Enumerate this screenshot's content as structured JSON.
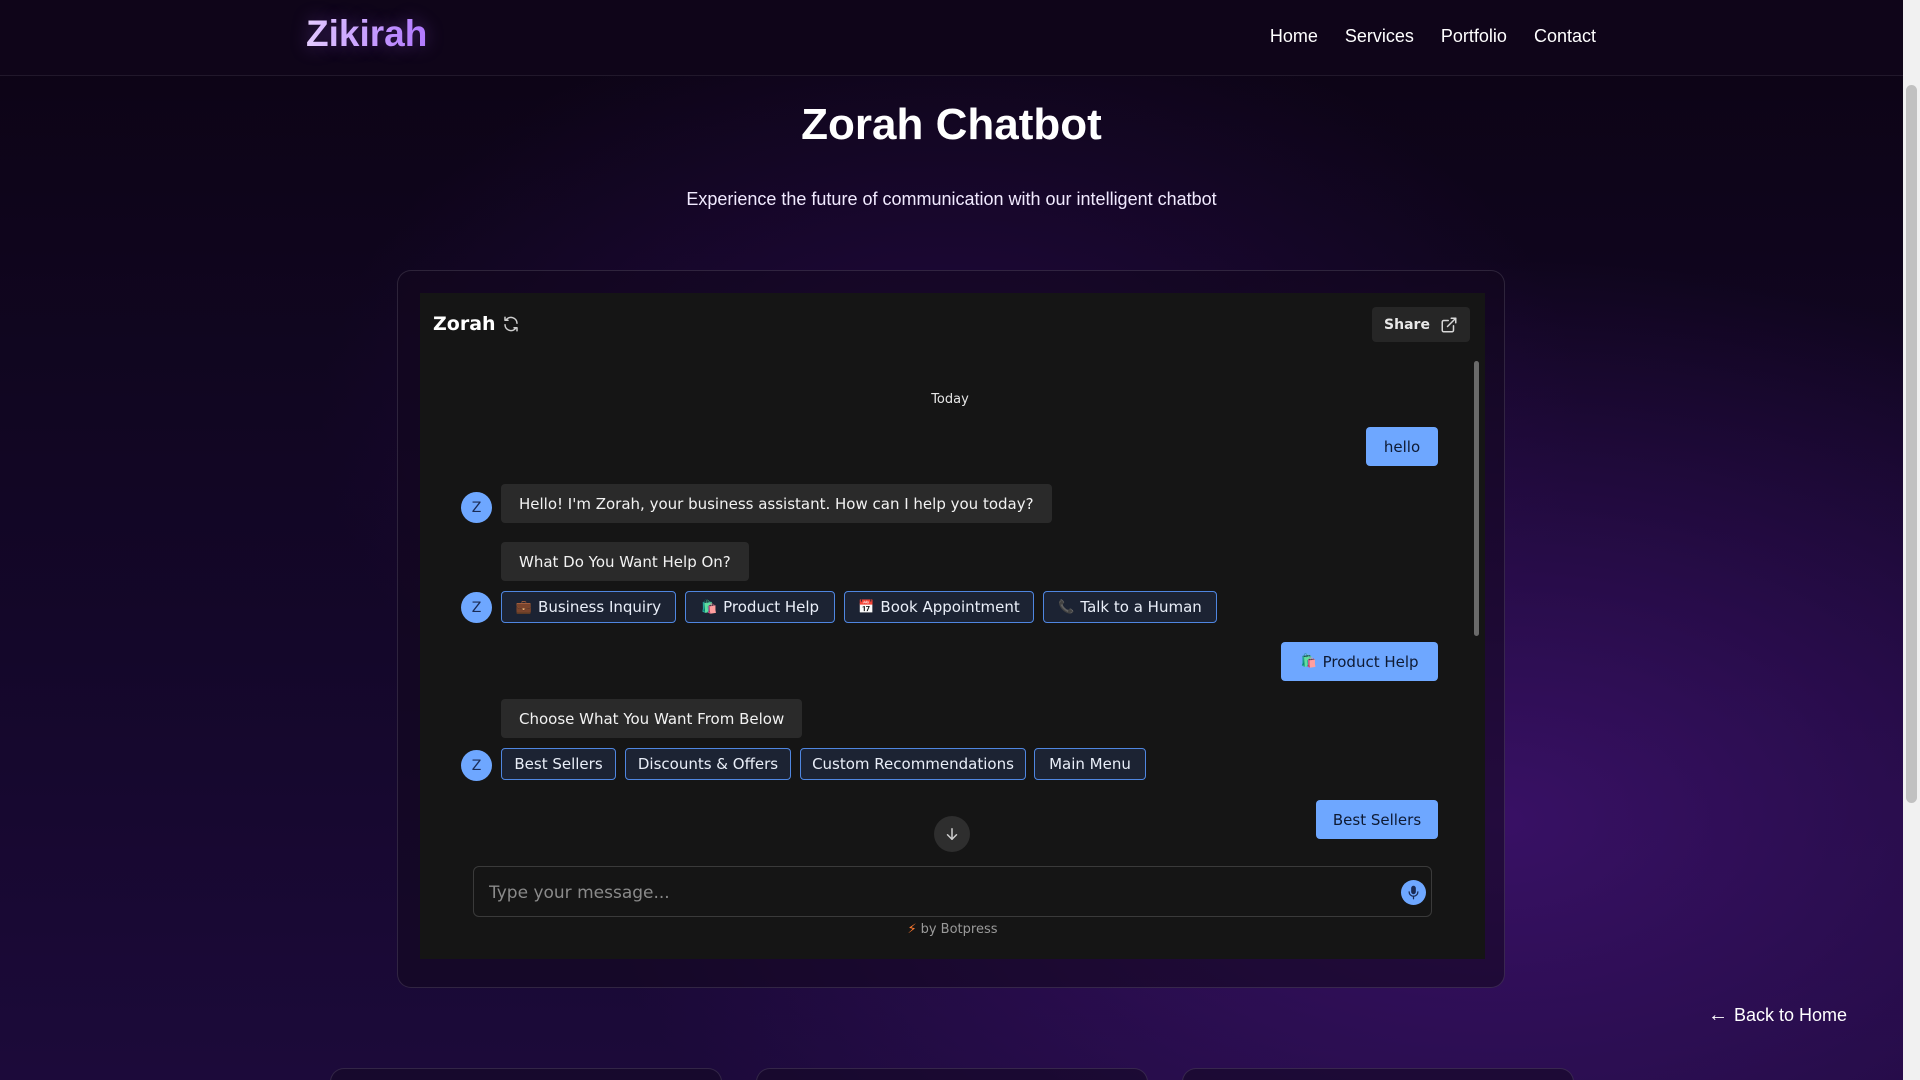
{
  "site": {
    "logo": "Zikirah",
    "nav": [
      "Home",
      "Services",
      "Portfolio",
      "Contact"
    ]
  },
  "hero": {
    "title": "Zorah Chatbot",
    "subtitle": "Experience the future of communication with our intelligent chatbot"
  },
  "chat": {
    "title": "Zorah",
    "share_label": "Share",
    "date_separator": "Today",
    "avatar_letter": "Z",
    "messages": {
      "user_hello": "hello",
      "bot_greeting": "Hello! I'm Zorah, your business assistant. How can I help you today?",
      "bot_question": "What Do You Want Help On?",
      "user_product_help": "Product Help",
      "bot_choose": "Choose What You Want From Below",
      "user_best_sellers": "Best Sellers"
    },
    "choices_main": [
      {
        "icon": "💼",
        "label": "Business Inquiry"
      },
      {
        "icon": "🛍️",
        "label": "Product Help"
      },
      {
        "icon": "📅",
        "label": "Book Appointment"
      },
      {
        "icon": "📞",
        "label": "Talk to a Human"
      }
    ],
    "user_product_help_icon": "🛍️",
    "choices_product": [
      "Best Sellers",
      "Discounts & Offers",
      "Custom Recommendations",
      "Main Menu"
    ],
    "composer_placeholder": "Type your message...",
    "powered_by": "by Botpress"
  },
  "back_link": "Back to Home",
  "colors": {
    "accent": "#6ea7ff",
    "background": "#10061c",
    "chat_bg": "#151515",
    "bot_bubble": "#2a2a2a"
  },
  "icons": [
    "refresh-icon",
    "share-external-icon",
    "arrow-down-icon",
    "microphone-icon",
    "lightning-icon",
    "arrow-left-icon"
  ]
}
